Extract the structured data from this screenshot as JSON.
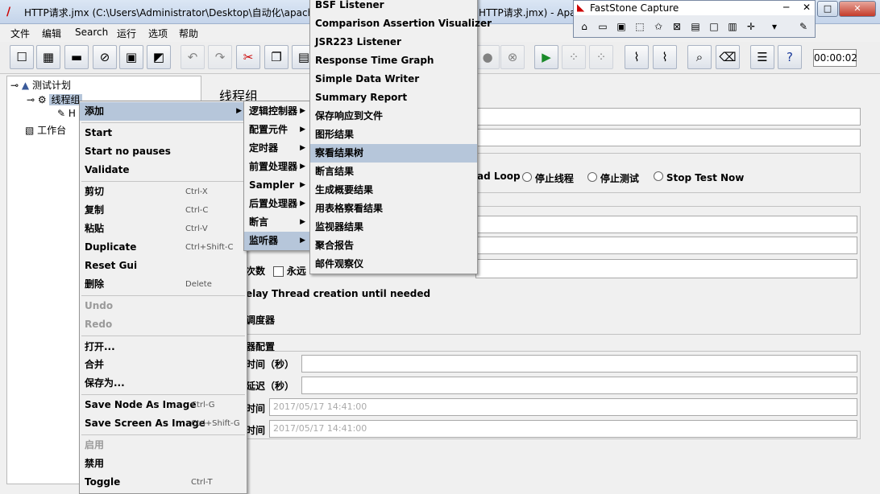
{
  "window": {
    "title": "HTTP请求.jmx (C:\\Users\\Administrator\\Desktop\\自动化\\apache",
    "title_right": "HTTP请求.jmx) - Apa",
    "min": "─",
    "max": "□",
    "close": "✕"
  },
  "menubar": [
    "文件",
    "编辑",
    "Search",
    "运行",
    "选项",
    "帮助"
  ],
  "toolbar": {
    "timer": "00:00:02"
  },
  "tree": {
    "plan": "测试计划",
    "thread_group": "线程组",
    "child": "H",
    "workbench": "工作台"
  },
  "panel": {
    "title": "线程组",
    "loop_label": "ad Loop",
    "stop_thread": "停止线程",
    "stop_test": "停止测试",
    "stop_test_now": "Stop Test Now",
    "loop_count": "次数",
    "forever": "永远",
    "delay": "elay Thread creation until needed",
    "scheduler": "调度器",
    "scheduler_config": "器配置",
    "duration": "时间（秒）",
    "startup_delay": "延迟（秒）",
    "start_time_label": "时间",
    "start_time": "2017/05/17 14:41:00",
    "end_time_label": "时间",
    "end_time": "2017/05/17 14:41:00"
  },
  "context_menu": {
    "items": [
      {
        "label": "添加",
        "arrow": "▶"
      },
      {
        "label": "Start"
      },
      {
        "label": "Start no pauses"
      },
      {
        "label": "Validate"
      },
      {
        "label": "剪切",
        "shortcut": "Ctrl-X"
      },
      {
        "label": "复制",
        "shortcut": "Ctrl-C"
      },
      {
        "label": "粘贴",
        "shortcut": "Ctrl-V"
      },
      {
        "label": "Duplicate",
        "shortcut": "Ctrl+Shift-C"
      },
      {
        "label": "Reset Gui"
      },
      {
        "label": "删除",
        "shortcut": "Delete"
      },
      {
        "label": "Undo"
      },
      {
        "label": "Redo"
      },
      {
        "label": "打开..."
      },
      {
        "label": "合并"
      },
      {
        "label": "保存为..."
      },
      {
        "label": "Save Node As Image",
        "shortcut": "Ctrl-G"
      },
      {
        "label": "Save Screen As Image",
        "shortcut": "Ctrl+Shift-G"
      },
      {
        "label": "启用"
      },
      {
        "label": "禁用"
      },
      {
        "label": "Toggle",
        "shortcut": "Ctrl-T"
      }
    ]
  },
  "submenu": {
    "items": [
      "逻辑控制器",
      "配置元件",
      "定时器",
      "前置处理器",
      "Sampler",
      "后置处理器",
      "断言",
      "监听器"
    ]
  },
  "listeners": {
    "items": [
      "BSF Listener",
      "Comparison Assertion Visualizer",
      "JSR223 Listener",
      "Response Time Graph",
      "Simple Data Writer",
      "Summary Report",
      "保存响应到文件",
      "图形结果",
      "察看结果树",
      "断言结果",
      "生成概要结果",
      "用表格察看结果",
      "监视器结果",
      "聚合报告",
      "邮件观察仪"
    ]
  },
  "faststone": {
    "title": "FastStone Capture",
    "close": "✕",
    "min": "─"
  },
  "colors": {
    "highlight": "#b6c6da",
    "titlebar": "#c4d4ea"
  }
}
